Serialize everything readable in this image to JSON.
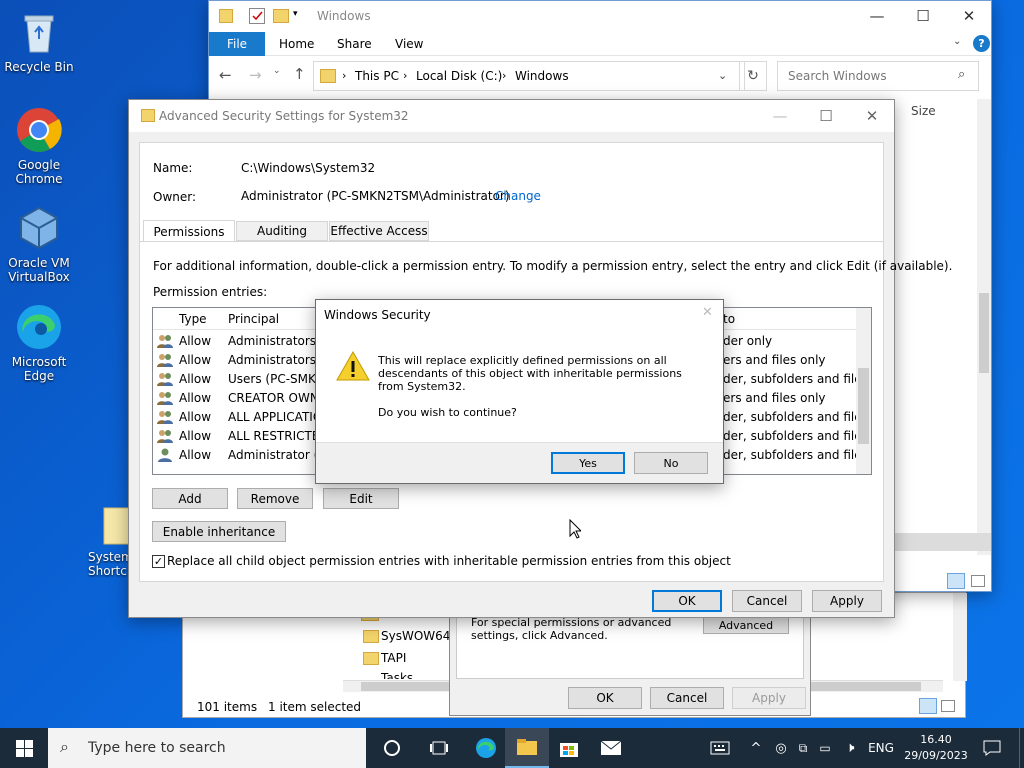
{
  "desktop": {
    "icons": [
      {
        "label": "Recycle Bin"
      },
      {
        "label": "Google Chrome"
      },
      {
        "label": "Oracle VM VirtualBox"
      },
      {
        "label": "Microsoft Edge"
      },
      {
        "label": "System3 Shortc"
      }
    ]
  },
  "explorer": {
    "title": "Windows",
    "ribbon_tabs": [
      "File",
      "Home",
      "Share",
      "View"
    ],
    "path": [
      "This PC",
      "Local Disk (C:)",
      "Windows"
    ],
    "search_placeholder": "Search Windows",
    "column_size": "Size",
    "folders": [
      "SysWOW64",
      "TAPI",
      "Tasks"
    ],
    "status_items": "101 items",
    "status_selected": "1 item selected"
  },
  "props_dialog": {
    "info_text": "For special permissions or advanced settings, click Advanced.",
    "advanced_label": "Advanced",
    "ok_label": "OK",
    "cancel_label": "Cancel",
    "apply_label": "Apply"
  },
  "adv": {
    "title": "Advanced Security Settings for System32",
    "name_label": "Name:",
    "name_value": "C:\\Windows\\System32",
    "owner_label": "Owner:",
    "owner_value": "Administrator (PC-SMKN2TSM\\Administrator)",
    "change_label": "Change",
    "tabs": [
      "Permissions",
      "Auditing",
      "Effective Access"
    ],
    "info": "For additional information, double-click a permission entry. To modify a permission entry, select the entry and click Edit (if available).",
    "entries_label": "Permission entries:",
    "col_type": "Type",
    "col_principal": "Principal",
    "col_applies": "to",
    "rows": [
      {
        "type": "Allow",
        "principal": "Administrators (P",
        "applies": "der only"
      },
      {
        "type": "Allow",
        "principal": "Administrators (P",
        "applies": "ers and files only"
      },
      {
        "type": "Allow",
        "principal": "Users (PC-SMKN",
        "applies": "der, subfolders and files"
      },
      {
        "type": "Allow",
        "principal": "CREATOR OWNE",
        "applies": "ers and files only"
      },
      {
        "type": "Allow",
        "principal": "ALL APPLICATION",
        "applies": "der, subfolders and files"
      },
      {
        "type": "Allow",
        "principal": "ALL RESTRICTED",
        "applies": "der, subfolders and files"
      },
      {
        "type": "Allow",
        "principal": "Administrator (P",
        "applies": "der, subfolders and files"
      }
    ],
    "add_label": "Add",
    "remove_label": "Remove",
    "edit_label": "Edit",
    "enable_inh_label": "Enable inheritance",
    "replace_label": "Replace all child object permission entries with inheritable permission entries from this object",
    "ok_label": "OK",
    "cancel_label": "Cancel",
    "apply_label": "Apply"
  },
  "security": {
    "title": "Windows Security",
    "message": "This will replace explicitly defined permissions on all descendants of this object with inheritable permissions from System32.",
    "question": "Do you wish to continue?",
    "yes_label": "Yes",
    "no_label": "No"
  },
  "taskbar": {
    "search_placeholder": "Type here to search",
    "lang": "ENG",
    "time": "16.40",
    "date": "29/09/2023"
  }
}
